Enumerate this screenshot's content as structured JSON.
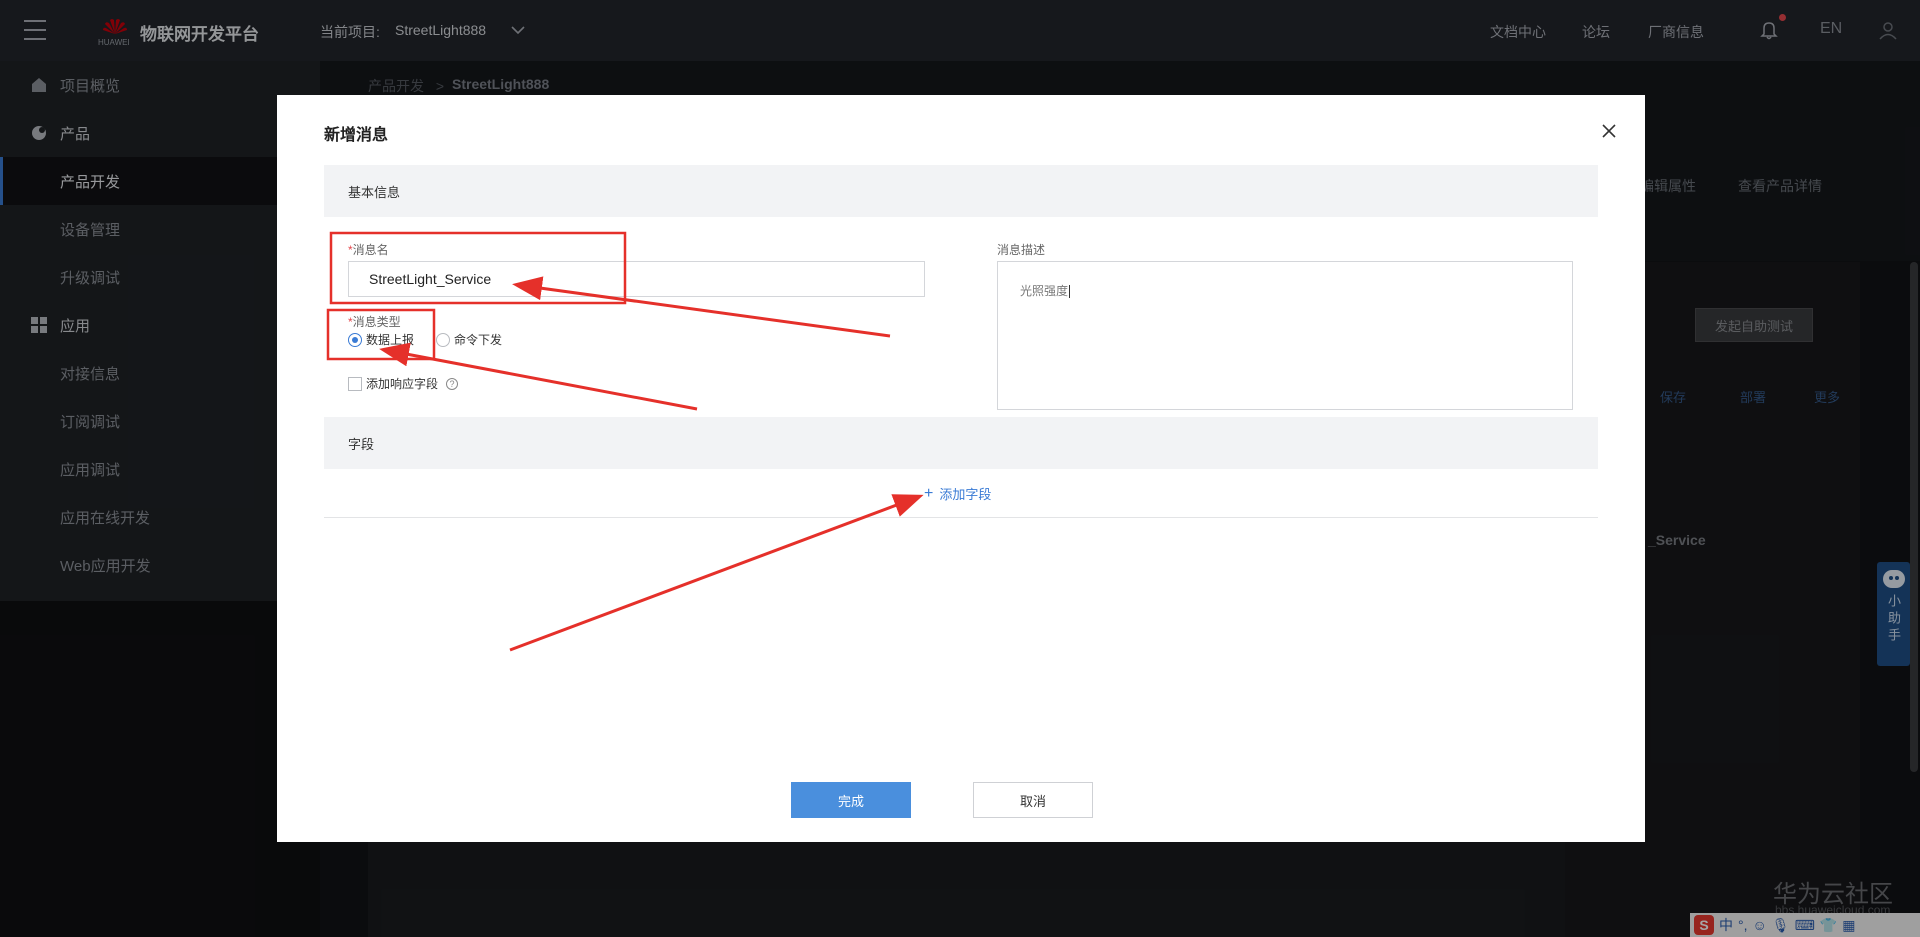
{
  "topbar": {
    "logo_text": "HUAWEI",
    "platform_title": "物联网开发平台",
    "current_project_label": "当前项目:",
    "project_name": "StreetLight888",
    "links": [
      "文档中心",
      "论坛",
      "厂商信息"
    ],
    "lang": "EN"
  },
  "sidebar": {
    "items": [
      {
        "label": "项目概览",
        "icon": "home-icon",
        "type": "group"
      },
      {
        "label": "产品",
        "icon": "product-icon",
        "type": "group"
      },
      {
        "label": "产品开发",
        "type": "child",
        "active": true
      },
      {
        "label": "设备管理",
        "type": "child"
      },
      {
        "label": "升级调试",
        "type": "child"
      },
      {
        "label": "应用",
        "icon": "apps-grid-icon",
        "type": "group"
      },
      {
        "label": "对接信息",
        "type": "child"
      },
      {
        "label": "订阅调试",
        "type": "child"
      },
      {
        "label": "应用调试",
        "type": "child"
      },
      {
        "label": "应用在线开发",
        "type": "child"
      },
      {
        "label": "Web应用开发",
        "type": "child"
      }
    ]
  },
  "background": {
    "breadcrumb_parent": "产品开发",
    "breadcrumb_separator": ">",
    "breadcrumb_current": "StreetLight888",
    "hero_links": [
      "编辑属性",
      "查看产品详情"
    ],
    "self_test_button": "发起自助测试",
    "actions": [
      "保存",
      "部署",
      "更多"
    ],
    "service_name": "_Service",
    "assistant": "小助手",
    "watermark": "华为云社区",
    "watermark_url": "bbs.huaweicloud.com",
    "ime": "中"
  },
  "dialog": {
    "title": "新增消息",
    "section_basic": "基本信息",
    "msg_name_label": "消息名",
    "msg_name_value": "StreetLight_Service",
    "msg_type_label": "消息类型",
    "msg_type_options": [
      "数据上报",
      "命令下发"
    ],
    "msg_type_selected": "数据上报",
    "add_response_label": "添加响应字段",
    "desc_label": "消息描述",
    "desc_value": "光照强度",
    "section_fields": "字段",
    "add_field": "添加字段",
    "done_button": "完成",
    "cancel_button": "取消"
  },
  "colors": {
    "accent": "#3a7bd5",
    "primary_button": "#4a8fdd",
    "annotation": "#e5302a"
  }
}
